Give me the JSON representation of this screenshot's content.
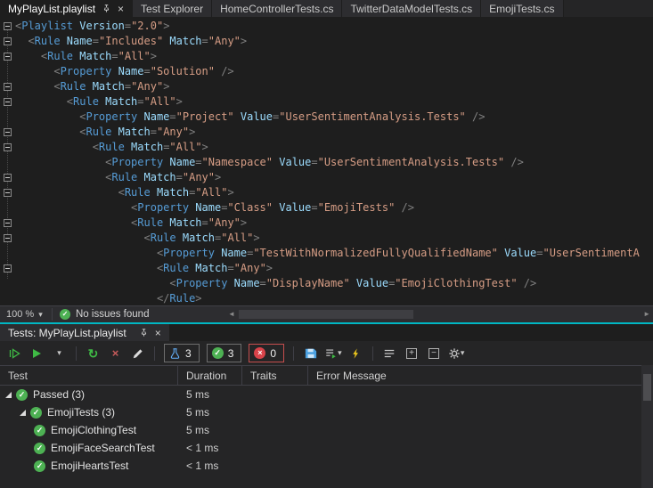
{
  "colors": {
    "panel_accent_teal": "#00b7c3",
    "pass_green": "#4db153",
    "fail_red": "#d8434a",
    "xml_element_blue": "#569cd6",
    "xml_attribute_blue": "#9cdcfe",
    "xml_value_orange": "#d69d85"
  },
  "icons": {
    "chevron_down": "▾",
    "close": "×",
    "check": "✓",
    "repeat": "↻",
    "cancel": "×",
    "scroll_left": "◄",
    "scroll_right": "►",
    "plus": "+",
    "minus": "−"
  },
  "editor_tabs": {
    "tabs": [
      {
        "label": "MyPlayList.playlist",
        "active": true
      },
      {
        "label": "Test Explorer",
        "active": false
      },
      {
        "label": "HomeControllerTests.cs",
        "active": false
      },
      {
        "label": "TwitterDataModelTests.cs",
        "active": false
      },
      {
        "label": "EmojiTests.cs",
        "active": false
      }
    ]
  },
  "editor": {
    "lines": [
      {
        "ind": 0,
        "fold": true,
        "tok": [
          [
            "d",
            "<"
          ],
          [
            "e",
            "Playlist"
          ],
          [
            "a",
            " Version"
          ],
          [
            "d",
            "="
          ],
          [
            "s",
            "\"2.0\""
          ],
          [
            "d",
            ">"
          ]
        ]
      },
      {
        "ind": 1,
        "fold": true,
        "tok": [
          [
            "d",
            "<"
          ],
          [
            "e",
            "Rule"
          ],
          [
            "a",
            " Name"
          ],
          [
            "d",
            "="
          ],
          [
            "s",
            "\"Includes\""
          ],
          [
            "a",
            " Match"
          ],
          [
            "d",
            "="
          ],
          [
            "s",
            "\"Any\""
          ],
          [
            "d",
            ">"
          ]
        ]
      },
      {
        "ind": 2,
        "fold": true,
        "tok": [
          [
            "d",
            "<"
          ],
          [
            "e",
            "Rule"
          ],
          [
            "a",
            " Match"
          ],
          [
            "d",
            "="
          ],
          [
            "s",
            "\"All\""
          ],
          [
            "d",
            ">"
          ]
        ]
      },
      {
        "ind": 3,
        "fold": false,
        "tok": [
          [
            "d",
            "<"
          ],
          [
            "e",
            "Property"
          ],
          [
            "a",
            " Name"
          ],
          [
            "d",
            "="
          ],
          [
            "s",
            "\"Solution\""
          ],
          [
            "d",
            " />"
          ]
        ]
      },
      {
        "ind": 3,
        "fold": true,
        "tok": [
          [
            "d",
            "<"
          ],
          [
            "e",
            "Rule"
          ],
          [
            "a",
            " Match"
          ],
          [
            "d",
            "="
          ],
          [
            "s",
            "\"Any\""
          ],
          [
            "d",
            ">"
          ]
        ]
      },
      {
        "ind": 4,
        "fold": true,
        "tok": [
          [
            "d",
            "<"
          ],
          [
            "e",
            "Rule"
          ],
          [
            "a",
            " Match"
          ],
          [
            "d",
            "="
          ],
          [
            "s",
            "\"All\""
          ],
          [
            "d",
            ">"
          ]
        ]
      },
      {
        "ind": 5,
        "fold": false,
        "tok": [
          [
            "d",
            "<"
          ],
          [
            "e",
            "Property"
          ],
          [
            "a",
            " Name"
          ],
          [
            "d",
            "="
          ],
          [
            "s",
            "\"Project\""
          ],
          [
            "a",
            " Value"
          ],
          [
            "d",
            "="
          ],
          [
            "s",
            "\"UserSentimentAnalysis.Tests\""
          ],
          [
            "d",
            " />"
          ]
        ]
      },
      {
        "ind": 5,
        "fold": true,
        "tok": [
          [
            "d",
            "<"
          ],
          [
            "e",
            "Rule"
          ],
          [
            "a",
            " Match"
          ],
          [
            "d",
            "="
          ],
          [
            "s",
            "\"Any\""
          ],
          [
            "d",
            ">"
          ]
        ]
      },
      {
        "ind": 6,
        "fold": true,
        "tok": [
          [
            "d",
            "<"
          ],
          [
            "e",
            "Rule"
          ],
          [
            "a",
            " Match"
          ],
          [
            "d",
            "="
          ],
          [
            "s",
            "\"All\""
          ],
          [
            "d",
            ">"
          ]
        ]
      },
      {
        "ind": 7,
        "fold": false,
        "tok": [
          [
            "d",
            "<"
          ],
          [
            "e",
            "Property"
          ],
          [
            "a",
            " Name"
          ],
          [
            "d",
            "="
          ],
          [
            "s",
            "\"Namespace\""
          ],
          [
            "a",
            " Value"
          ],
          [
            "d",
            "="
          ],
          [
            "s",
            "\"UserSentimentAnalysis.Tests\""
          ],
          [
            "d",
            " />"
          ]
        ]
      },
      {
        "ind": 7,
        "fold": true,
        "tok": [
          [
            "d",
            "<"
          ],
          [
            "e",
            "Rule"
          ],
          [
            "a",
            " Match"
          ],
          [
            "d",
            "="
          ],
          [
            "s",
            "\"Any\""
          ],
          [
            "d",
            ">"
          ]
        ]
      },
      {
        "ind": 8,
        "fold": true,
        "tok": [
          [
            "d",
            "<"
          ],
          [
            "e",
            "Rule"
          ],
          [
            "a",
            " Match"
          ],
          [
            "d",
            "="
          ],
          [
            "s",
            "\"All\""
          ],
          [
            "d",
            ">"
          ]
        ]
      },
      {
        "ind": 9,
        "fold": false,
        "tok": [
          [
            "d",
            "<"
          ],
          [
            "e",
            "Property"
          ],
          [
            "a",
            " Name"
          ],
          [
            "d",
            "="
          ],
          [
            "s",
            "\"Class\""
          ],
          [
            "a",
            " Value"
          ],
          [
            "d",
            "="
          ],
          [
            "s",
            "\"EmojiTests\""
          ],
          [
            "d",
            " />"
          ]
        ]
      },
      {
        "ind": 9,
        "fold": true,
        "tok": [
          [
            "d",
            "<"
          ],
          [
            "e",
            "Rule"
          ],
          [
            "a",
            " Match"
          ],
          [
            "d",
            "="
          ],
          [
            "s",
            "\"Any\""
          ],
          [
            "d",
            ">"
          ]
        ]
      },
      {
        "ind": 10,
        "fold": true,
        "tok": [
          [
            "d",
            "<"
          ],
          [
            "e",
            "Rule"
          ],
          [
            "a",
            " Match"
          ],
          [
            "d",
            "="
          ],
          [
            "s",
            "\"All\""
          ],
          [
            "d",
            ">"
          ]
        ]
      },
      {
        "ind": 11,
        "fold": false,
        "tok": [
          [
            "d",
            "<"
          ],
          [
            "e",
            "Property"
          ],
          [
            "a",
            " Name"
          ],
          [
            "d",
            "="
          ],
          [
            "s",
            "\"TestWithNormalizedFullyQualifiedName\""
          ],
          [
            "a",
            " Value"
          ],
          [
            "d",
            "="
          ],
          [
            "s",
            "\"UserSentimentA"
          ]
        ]
      },
      {
        "ind": 11,
        "fold": true,
        "tok": [
          [
            "d",
            "<"
          ],
          [
            "e",
            "Rule"
          ],
          [
            "a",
            " Match"
          ],
          [
            "d",
            "="
          ],
          [
            "s",
            "\"Any\""
          ],
          [
            "d",
            ">"
          ]
        ]
      },
      {
        "ind": 12,
        "fold": false,
        "tok": [
          [
            "d",
            "<"
          ],
          [
            "e",
            "Property"
          ],
          [
            "a",
            " Name"
          ],
          [
            "d",
            "="
          ],
          [
            "s",
            "\"DisplayName\""
          ],
          [
            "a",
            " Value"
          ],
          [
            "d",
            "="
          ],
          [
            "s",
            "\"EmojiClothingTest\""
          ],
          [
            "d",
            " />"
          ]
        ]
      },
      {
        "ind": 11,
        "fold": false,
        "tok": [
          [
            "d",
            "</"
          ],
          [
            "e",
            "Rule"
          ],
          [
            "d",
            ">"
          ]
        ]
      }
    ]
  },
  "editor_statusbar": {
    "zoom": "100 %",
    "status": "No issues found"
  },
  "tests_panel": {
    "tab_label": "Tests: MyPlayList.playlist",
    "toolbar": {
      "total_count": "3",
      "passed_count": "3",
      "failed_count": "0"
    },
    "columns": [
      "Test",
      "Duration",
      "Traits",
      "Error Message"
    ],
    "rows": [
      {
        "level": 0,
        "exp": true,
        "label": "Passed (3)",
        "duration": "5 ms"
      },
      {
        "level": 1,
        "exp": true,
        "label": "EmojiTests (3)",
        "duration": "5 ms"
      },
      {
        "level": 2,
        "exp": false,
        "label": "EmojiClothingTest",
        "duration": "5 ms"
      },
      {
        "level": 2,
        "exp": false,
        "label": "EmojiFaceSearchTest",
        "duration": "< 1 ms"
      },
      {
        "level": 2,
        "exp": false,
        "label": "EmojiHeartsTest",
        "duration": "< 1 ms"
      }
    ]
  }
}
